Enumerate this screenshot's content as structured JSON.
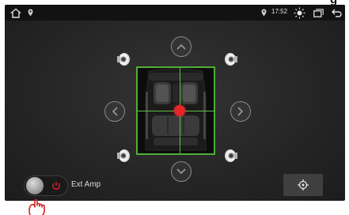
{
  "status_bar": {
    "time": "17:52",
    "icons": [
      "home-icon",
      "location-pin-icon",
      "location-pin-icon",
      "brightness-icon",
      "window-icon",
      "back-icon"
    ]
  },
  "title_glyph": "g",
  "controls": {
    "arrows": [
      "arrow-up-icon",
      "arrow-down-icon",
      "arrow-left-icon",
      "arrow-right-icon"
    ],
    "speakers": [
      "speaker-front-left",
      "speaker-front-right",
      "speaker-rear-left",
      "speaker-rear-right"
    ],
    "ext_amp_label": "Ext Amp",
    "ext_amp_state": "on"
  },
  "colors": {
    "accent_green": "#4fae3c",
    "focus_red": "#e3262a",
    "power_red": "#d11f24"
  }
}
